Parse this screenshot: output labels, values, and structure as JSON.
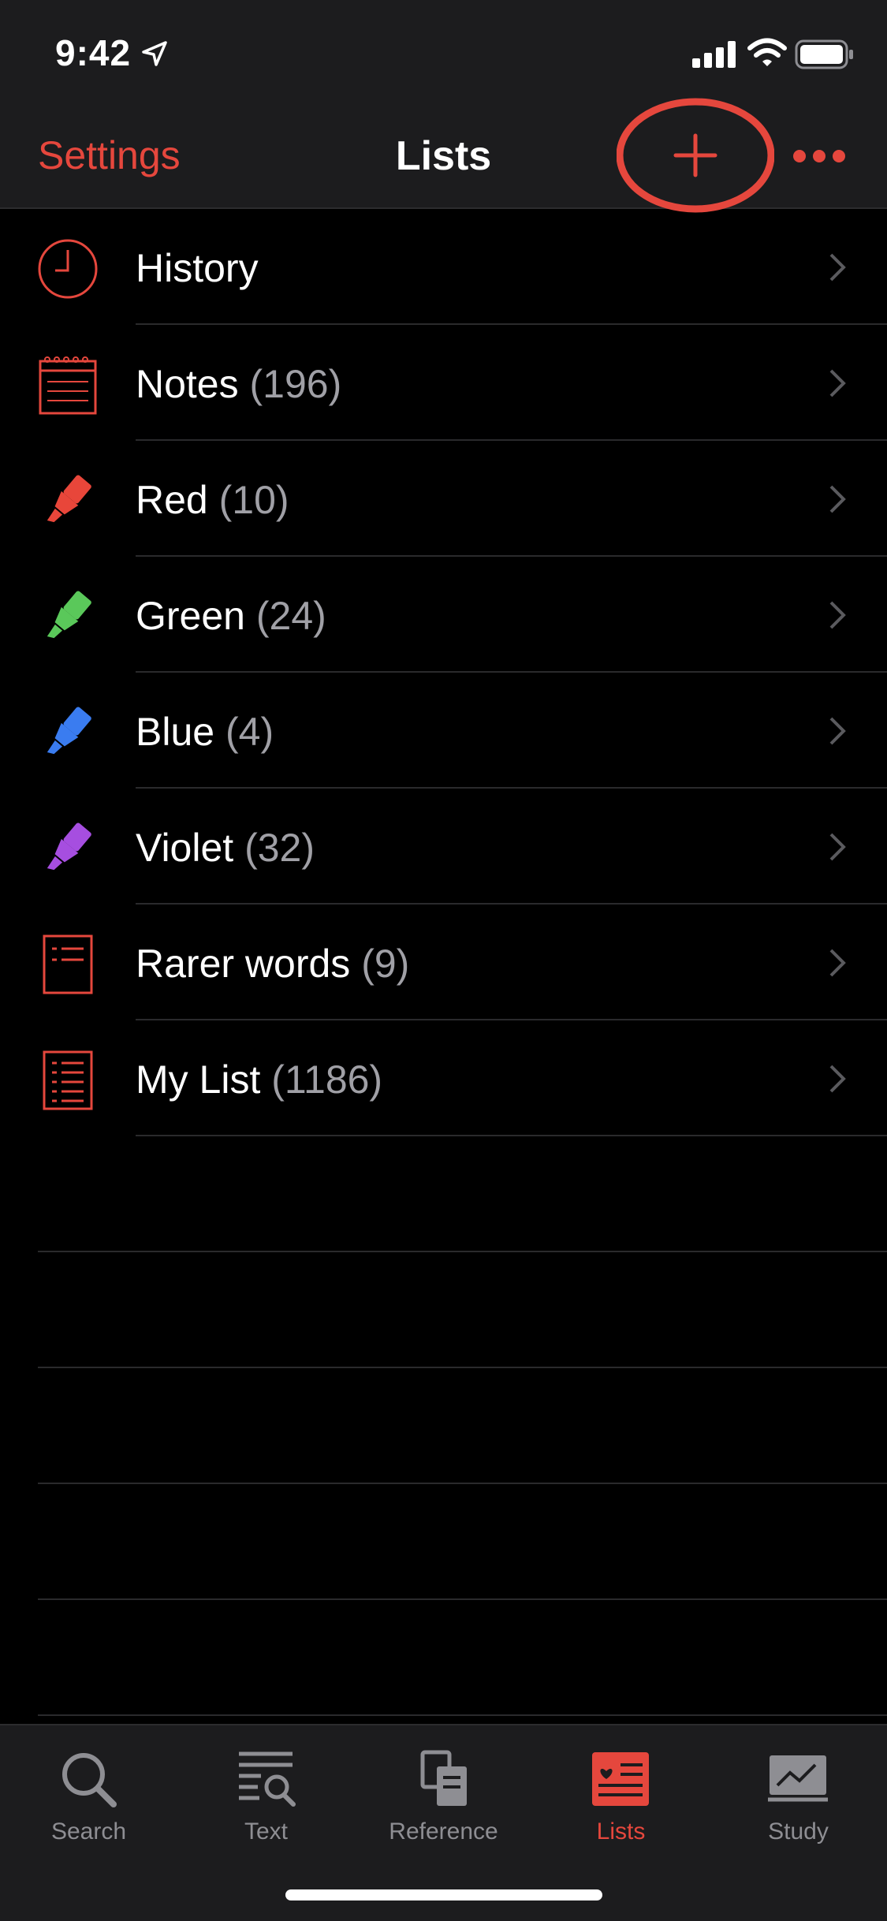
{
  "status_bar": {
    "time": "9:42"
  },
  "nav": {
    "settings_label": "Settings",
    "title": "Lists"
  },
  "lists": [
    {
      "name": "History",
      "count": "",
      "icon": "clock-icon"
    },
    {
      "name": "Notes",
      "count": "(196)",
      "icon": "notepad-icon"
    },
    {
      "name": "Red",
      "count": "(10)",
      "icon": "highlighter-red-icon",
      "color": "#e8463a"
    },
    {
      "name": "Green",
      "count": "(24)",
      "icon": "highlighter-green-icon",
      "color": "#5ac85a"
    },
    {
      "name": "Blue",
      "count": "(4)",
      "icon": "highlighter-blue-icon",
      "color": "#3a7cf0"
    },
    {
      "name": "Violet",
      "count": "(32)",
      "icon": "highlighter-violet-icon",
      "color": "#a64ee0"
    },
    {
      "name": "Rarer words",
      "count": "(9)",
      "icon": "document-list-icon"
    },
    {
      "name": "My List",
      "count": "(1186)",
      "icon": "document-list-icon"
    }
  ],
  "tabs": [
    {
      "label": "Search",
      "icon": "magnifier-icon"
    },
    {
      "label": "Text",
      "icon": "text-search-icon"
    },
    {
      "label": "Reference",
      "icon": "books-icon"
    },
    {
      "label": "Lists",
      "icon": "lists-heart-icon"
    },
    {
      "label": "Study",
      "icon": "chart-icon"
    }
  ],
  "colors": {
    "accent": "#e5473d",
    "bar_background": "#1c1c1e",
    "background": "#000000",
    "count_text": "#a0a0a6",
    "inactive_tab": "#8e8e93"
  }
}
